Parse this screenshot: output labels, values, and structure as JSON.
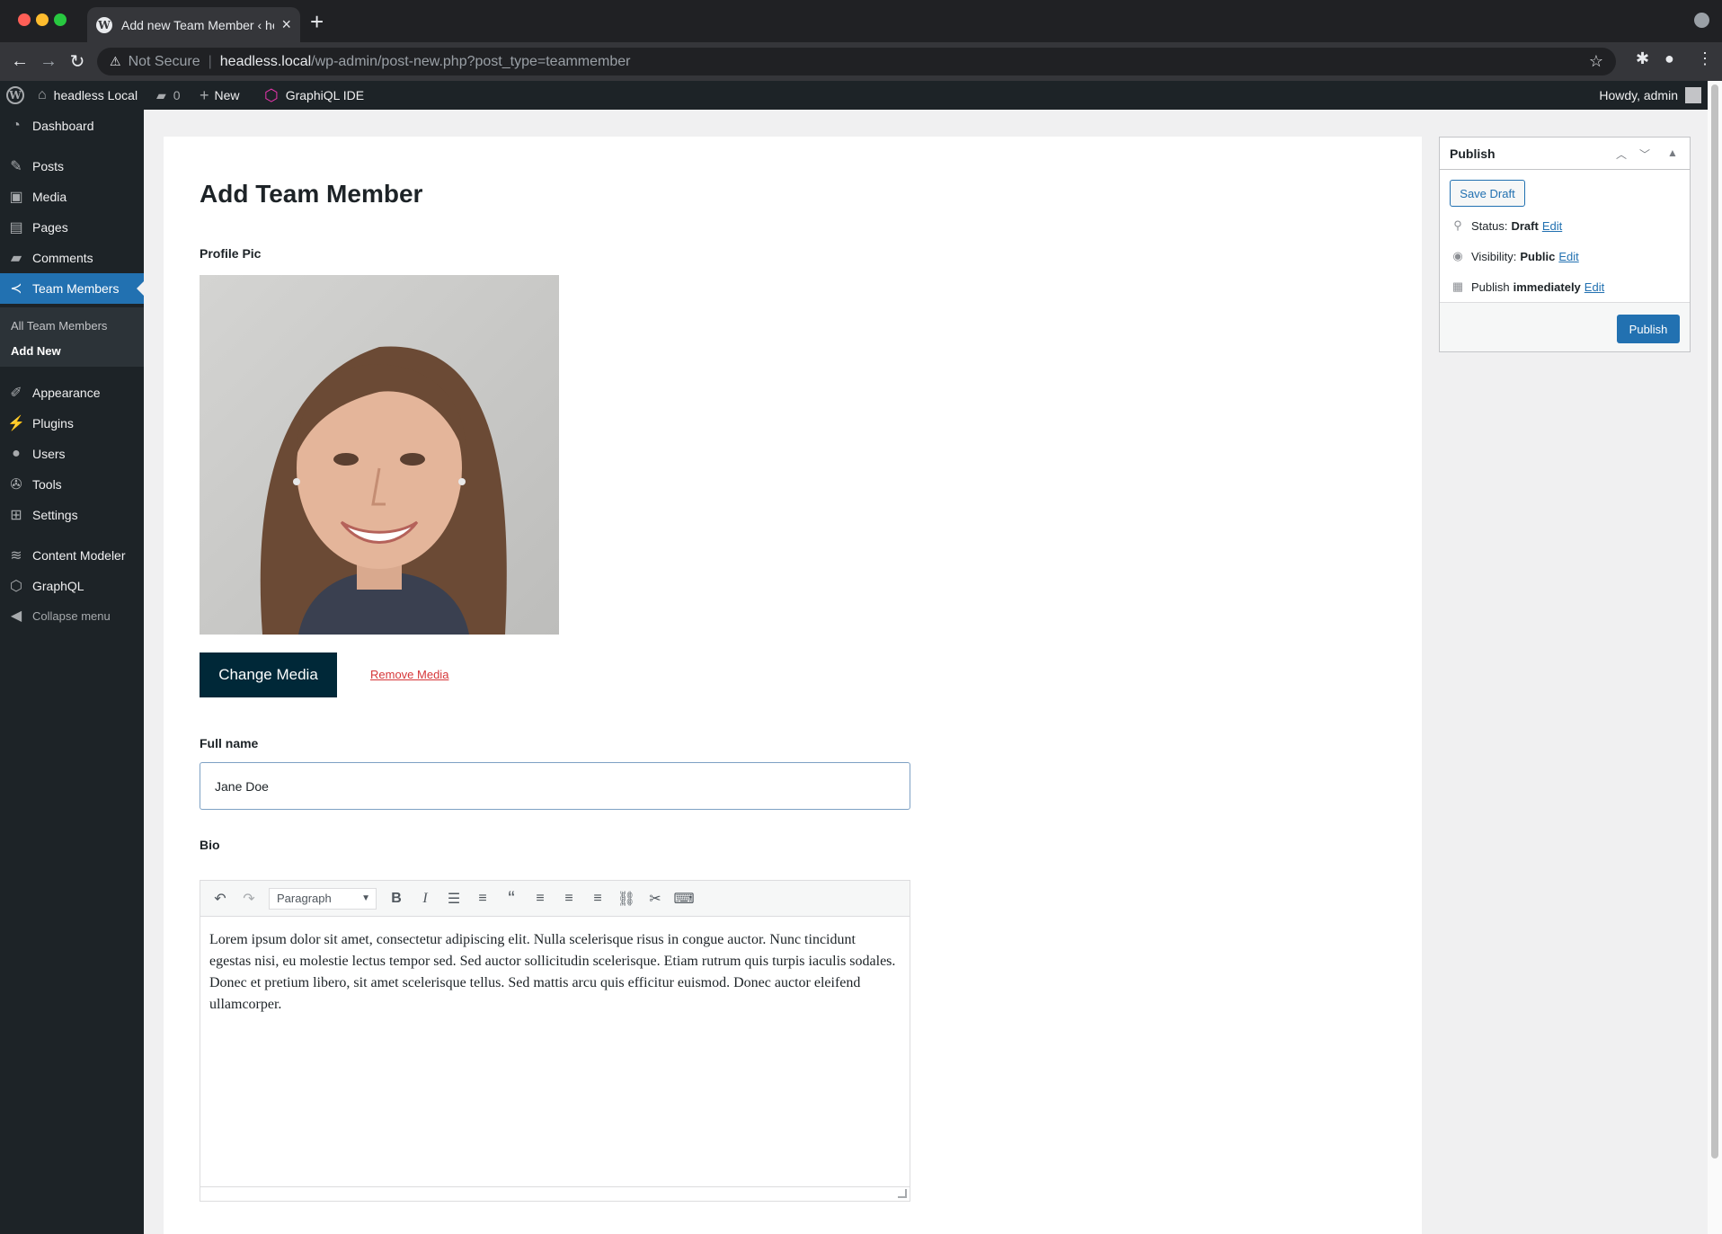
{
  "browser": {
    "tab_title": "Add new Team Member ‹ headl",
    "tab_close": "×",
    "new_tab": "+",
    "security_label": "Not Secure",
    "url_host": "headless.local",
    "url_path": "/wp-admin/post-new.php?post_type=teammember"
  },
  "adminbar": {
    "site_name": "headless Local",
    "comments_count": "0",
    "new_label": "New",
    "graphiql_label": "GraphiQL IDE",
    "howdy": "Howdy, admin"
  },
  "menu": {
    "dashboard": "Dashboard",
    "posts": "Posts",
    "media": "Media",
    "pages": "Pages",
    "comments": "Comments",
    "team_members": "Team Members",
    "sub_all": "All Team Members",
    "sub_add": "Add New",
    "appearance": "Appearance",
    "plugins": "Plugins",
    "users": "Users",
    "tools": "Tools",
    "settings": "Settings",
    "content_modeler": "Content Modeler",
    "graphql": "GraphQL",
    "collapse": "Collapse menu"
  },
  "main": {
    "title": "Add Team Member",
    "profile_pic_label": "Profile Pic",
    "change_media": "Change Media",
    "remove_media": "Remove Media",
    "full_name_label": "Full name",
    "full_name_value": "Jane Doe",
    "bio_label": "Bio",
    "format_select": "Paragraph",
    "bio_text": "Lorem ipsum dolor sit amet, consectetur adipiscing elit. Nulla scelerisque risus in congue auctor. Nunc tincidunt egestas nisi, eu molestie lectus tempor sed. Sed auctor sollicitudin scelerisque. Etiam rutrum quis turpis iaculis sodales. Donec et pretium libero, sit amet scelerisque tellus. Sed mattis arcu quis efficitur euismod. Donec auctor eleifend ullamcorper."
  },
  "publish": {
    "title": "Publish",
    "save_draft": "Save Draft",
    "status_label": "Status:",
    "status_value": "Draft",
    "visibility_label": "Visibility:",
    "visibility_value": "Public",
    "publish_label": "Publish",
    "publish_value": "immediately",
    "edit": "Edit",
    "publish_button": "Publish"
  },
  "colors": {
    "admin_dark": "#1d2327",
    "accent_blue": "#2271b1",
    "change_media_bg": "#002838",
    "remove_media": "#d63638"
  }
}
